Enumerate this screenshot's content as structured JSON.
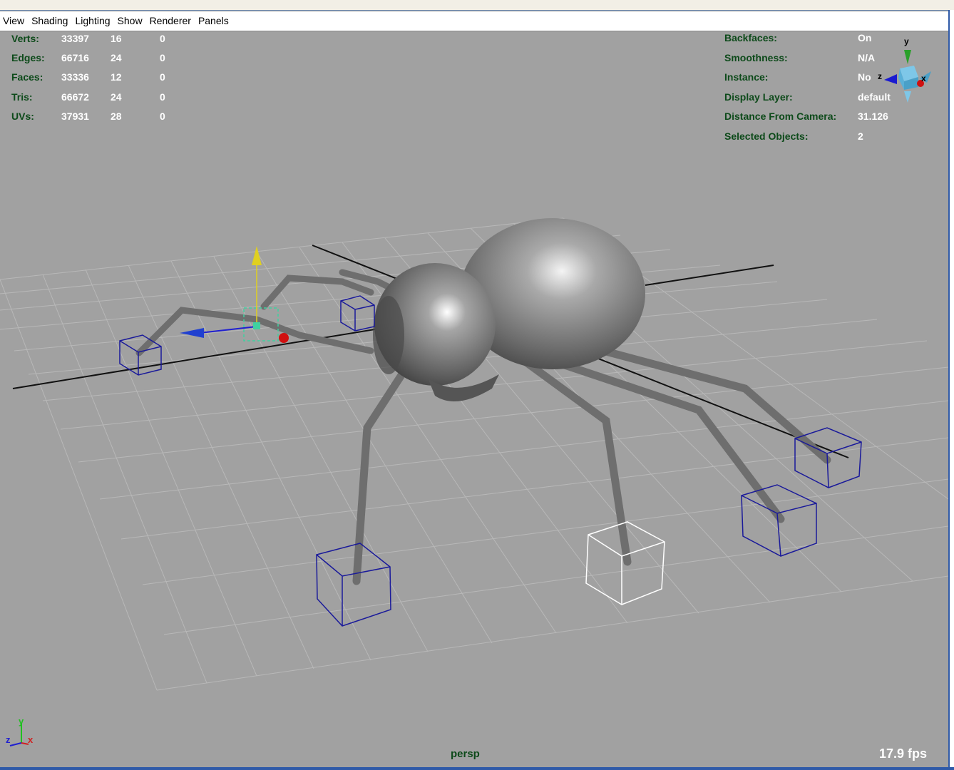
{
  "menu": [
    "View",
    "Shading",
    "Lighting",
    "Show",
    "Renderer",
    "Panels"
  ],
  "poly_stats": [
    {
      "label": "Verts:",
      "total": "33397",
      "selected": "16",
      "component": "0"
    },
    {
      "label": "Edges:",
      "total": "66716",
      "selected": "24",
      "component": "0"
    },
    {
      "label": "Faces:",
      "total": "33336",
      "selected": "12",
      "component": "0"
    },
    {
      "label": "Tris:",
      "total": "66672",
      "selected": "24",
      "component": "0"
    },
    {
      "label": "UVs:",
      "total": "37931",
      "selected": "28",
      "component": "0"
    }
  ],
  "object_info": [
    {
      "label": "Backfaces:",
      "value": "On"
    },
    {
      "label": "Smoothness:",
      "value": "N/A"
    },
    {
      "label": "Instance:",
      "value": "No"
    },
    {
      "label": "Display Layer:",
      "value": "default"
    },
    {
      "label": "Distance From Camera:",
      "value": "31.126"
    },
    {
      "label": "Selected Objects:",
      "value": "2"
    }
  ],
  "view_cube": {
    "y": "y",
    "z": "z",
    "x": "x"
  },
  "axis_indicator": {
    "y": "y",
    "z": "z",
    "x": "x"
  },
  "camera_label": "persp",
  "fps": "17.9 fps",
  "colors": {
    "viewport_bg": "#a1a1a1",
    "hud_label": "#0d4a1a",
    "hud_value": "#ffffff",
    "grid": "#b9b9b9",
    "ik_handle": "#1a1a9a",
    "selected_handle": "#ffffff",
    "mesh": "#7a7a7a"
  }
}
